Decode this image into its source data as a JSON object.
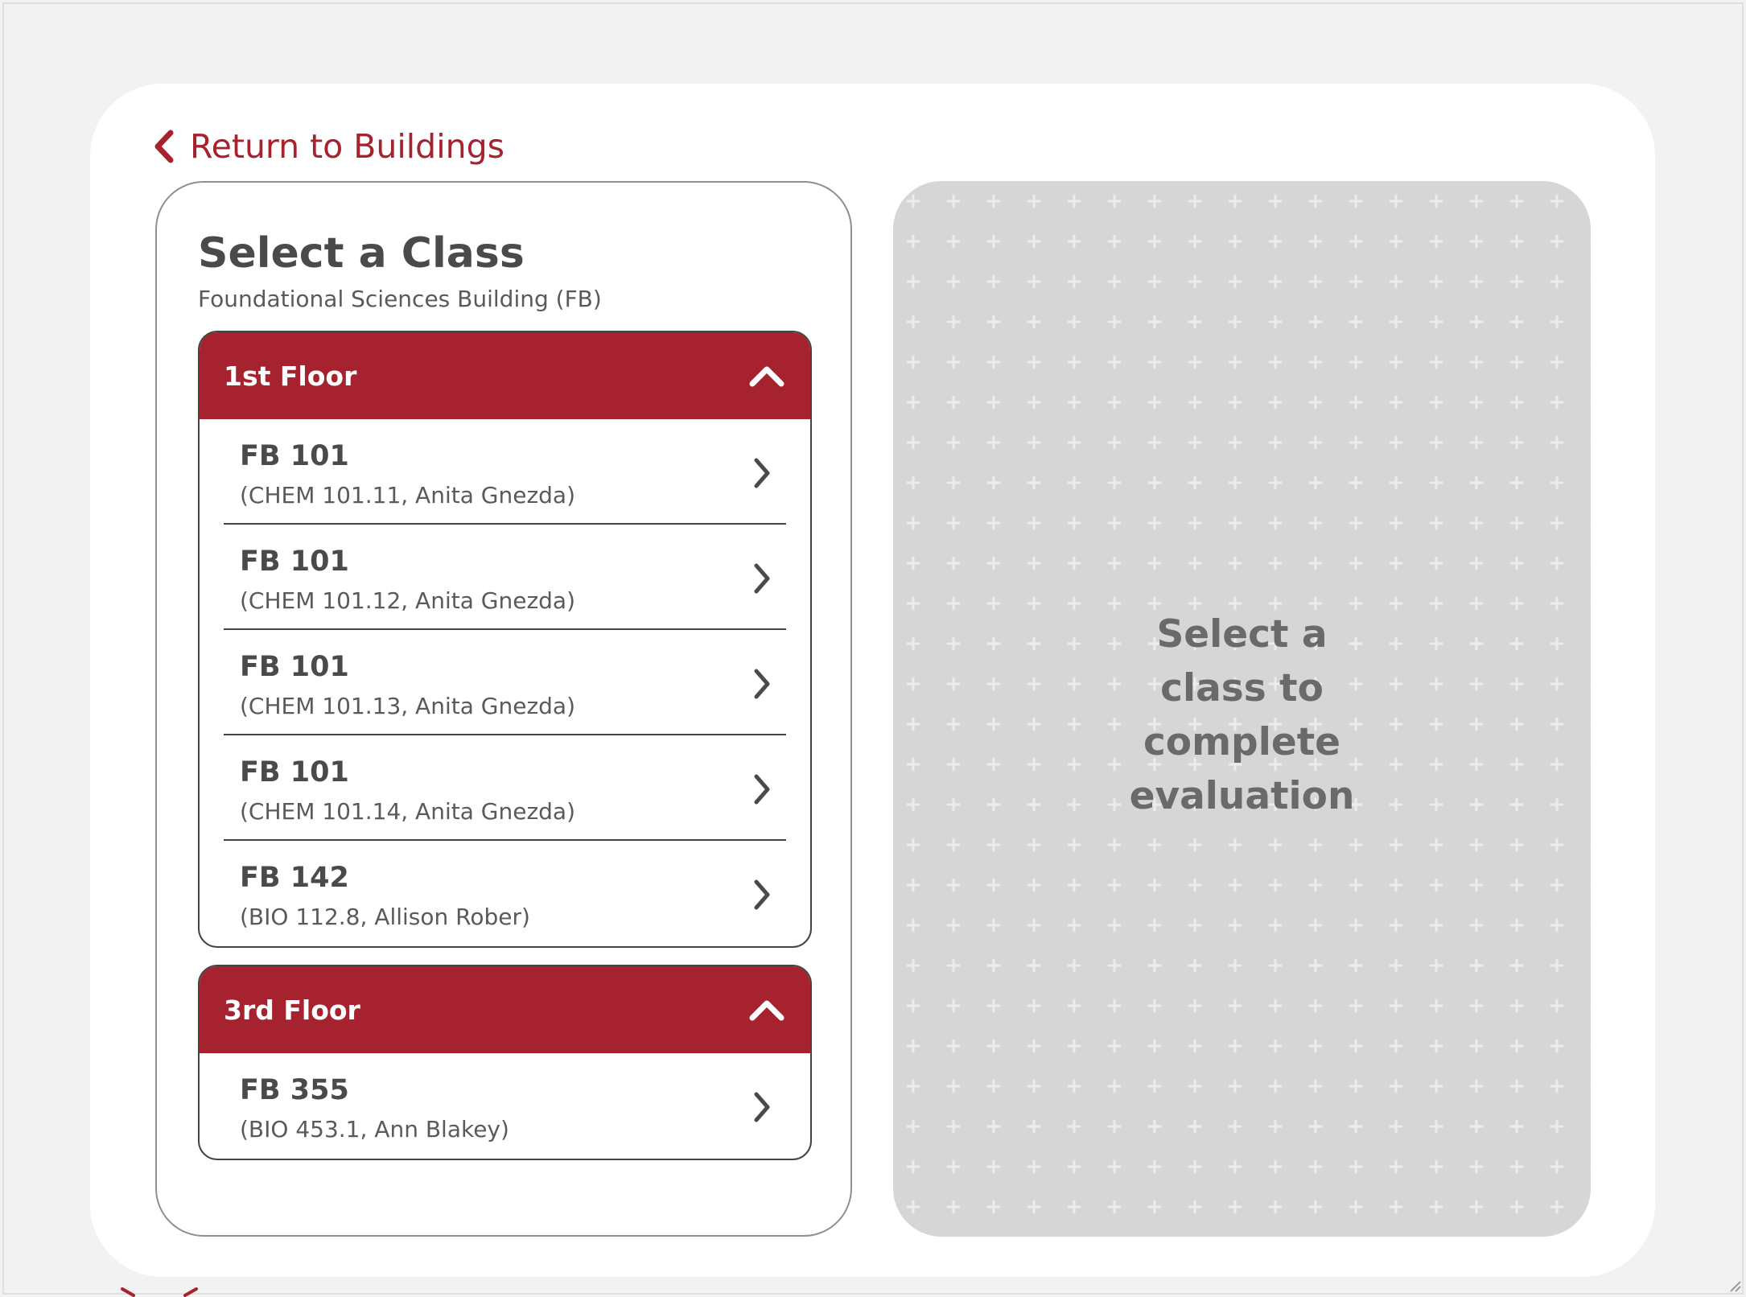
{
  "nav": {
    "back_label": "Return to Buildings"
  },
  "panel": {
    "title": "Select a Class",
    "subtitle": "Foundational Sciences Building (FB)",
    "floors": [
      {
        "label": "1st Floor",
        "expanded": true,
        "classes": [
          {
            "room": "FB 101",
            "detail": "(CHEM 101.11, Anita Gnezda)"
          },
          {
            "room": "FB 101",
            "detail": "(CHEM 101.12, Anita Gnezda)"
          },
          {
            "room": "FB 101",
            "detail": "(CHEM 101.13, Anita Gnezda)"
          },
          {
            "room": "FB 101",
            "detail": "(CHEM 101.14, Anita Gnezda)"
          },
          {
            "room": "FB 142",
            "detail": "(BIO 112.8, Allison Rober)"
          }
        ]
      },
      {
        "label": "3rd Floor",
        "expanded": true,
        "classes": [
          {
            "room": "FB 355",
            "detail": "(BIO 453.1, Ann Blakey)"
          }
        ]
      }
    ]
  },
  "placeholder": {
    "message_lines": [
      "Select a",
      "class to",
      "complete",
      "evaluation"
    ]
  },
  "colors": {
    "accent": "#a6222f",
    "text": "#4a4a4a",
    "placeholder_bg": "#d6d6d6"
  },
  "icons": {
    "back": "chevron-left-icon",
    "collapse": "chevron-up-icon",
    "row": "chevron-right-icon"
  }
}
